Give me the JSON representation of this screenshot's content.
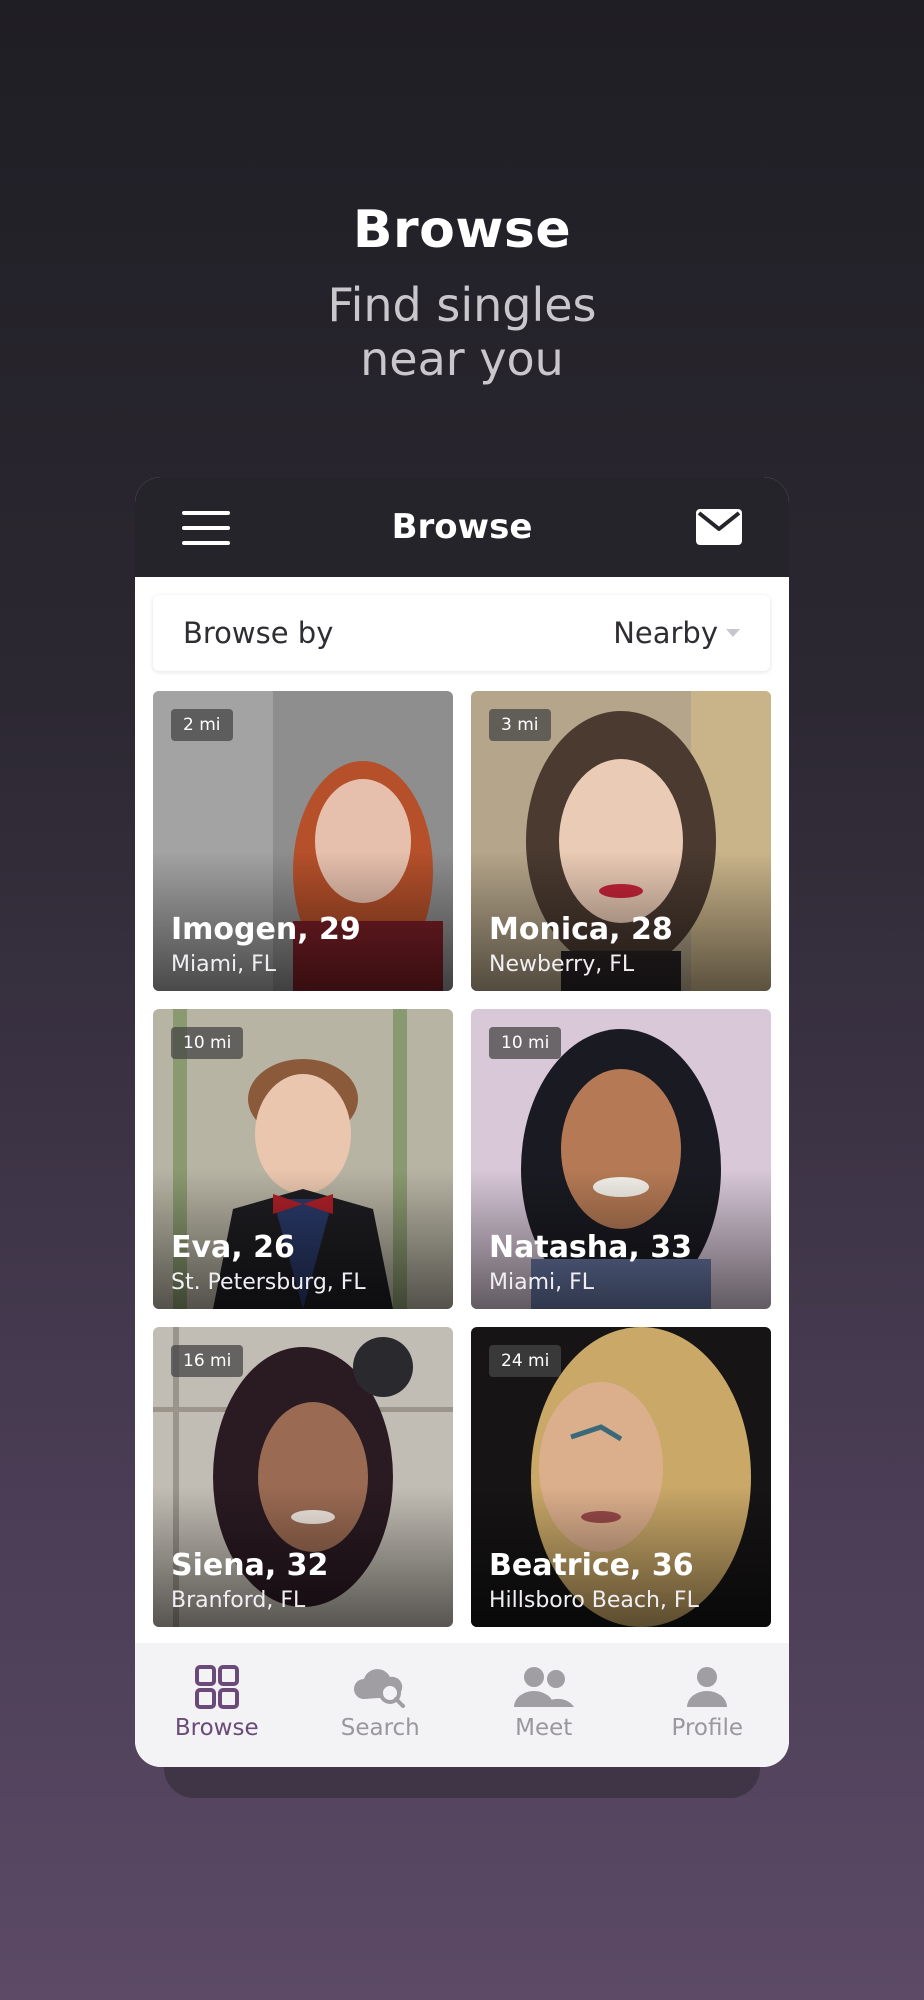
{
  "hero": {
    "title": "Browse",
    "subtitle_line1": "Find singles",
    "subtitle_line2": "near you"
  },
  "app_bar": {
    "title": "Browse",
    "menu_icon": "hamburger-icon",
    "mail_icon": "envelope-icon"
  },
  "browse_by": {
    "label": "Browse by",
    "selected": "Nearby"
  },
  "profiles": [
    {
      "name_age": "Imogen, 29",
      "location": "Miami, FL",
      "distance": "2 mi",
      "bg": "#8e8e8e",
      "hair": "#b5502a"
    },
    {
      "name_age": "Monica, 28",
      "location": "Newberry, FL",
      "distance": "3 mi",
      "bg": "#b5a58a",
      "hair": "#4a3a30"
    },
    {
      "name_age": "Eva, 26",
      "location": "St. Petersburg, FL",
      "distance": "10 mi",
      "bg": "#b8b4a4",
      "hair": "#8a5a3a"
    },
    {
      "name_age": "Natasha, 33",
      "location": "Miami, FL",
      "distance": "10 mi",
      "bg": "#d8c8d8",
      "hair": "#1a1a22"
    },
    {
      "name_age": "Siena, 32",
      "location": "Branford, FL",
      "distance": "16 mi",
      "bg": "#c2bdb4",
      "hair": "#2a1a22"
    },
    {
      "name_age": "Beatrice, 36",
      "location": "Hillsboro Beach, FL",
      "distance": "24 mi",
      "bg": "#161414",
      "hair": "#c9a868"
    }
  ],
  "nav": [
    {
      "label": "Browse",
      "icon": "grid-icon",
      "active": true
    },
    {
      "label": "Search",
      "icon": "cloud-search-icon",
      "active": false
    },
    {
      "label": "Meet",
      "icon": "people-icon",
      "active": false
    },
    {
      "label": "Profile",
      "icon": "person-icon",
      "active": false
    }
  ],
  "colors": {
    "accent": "#6a4a78",
    "inactive": "#9a979e",
    "app_bar": "#25242a"
  }
}
